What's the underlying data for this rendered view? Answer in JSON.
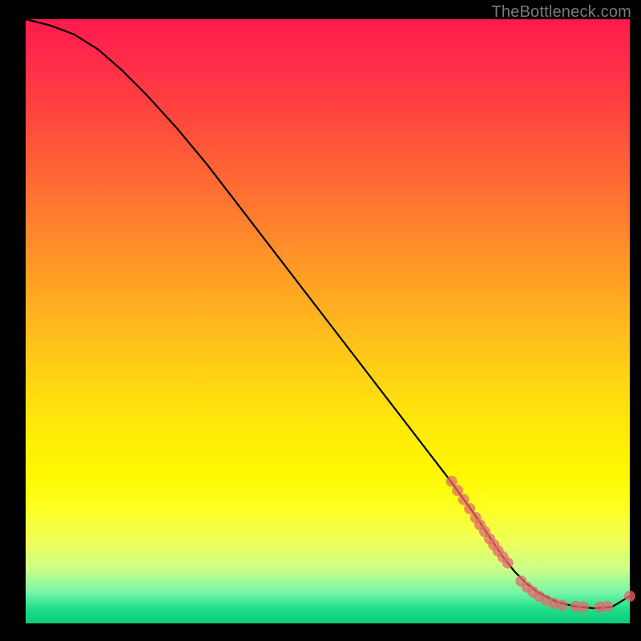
{
  "attribution": "TheBottleneck.com",
  "chart_data": {
    "type": "line",
    "title": "",
    "xlabel": "",
    "ylabel": "",
    "xlim": [
      0,
      100
    ],
    "ylim": [
      0,
      100
    ],
    "series": [
      {
        "name": "curve",
        "x": [
          0,
          4,
          8,
          12,
          16,
          20,
          25,
          30,
          35,
          40,
          45,
          50,
          55,
          60,
          65,
          70,
          74,
          77,
          79,
          81,
          83,
          85,
          88,
          91,
          94,
          97,
          100
        ],
        "y": [
          100,
          99,
          97.5,
          95,
          91.5,
          87.5,
          82,
          76,
          69.5,
          63,
          56.5,
          50,
          43.5,
          37,
          30.5,
          24,
          18.5,
          14,
          11,
          8.5,
          6.5,
          5,
          3.5,
          2.8,
          2.5,
          2.7,
          4.5
        ]
      }
    ],
    "markers": [
      {
        "x": 70.5,
        "y": 23.5
      },
      {
        "x": 71.5,
        "y": 22.0
      },
      {
        "x": 72.5,
        "y": 20.5
      },
      {
        "x": 73.5,
        "y": 19.0
      },
      {
        "x": 74.5,
        "y": 17.5
      },
      {
        "x": 75.2,
        "y": 16.3
      },
      {
        "x": 76.0,
        "y": 15.2
      },
      {
        "x": 76.8,
        "y": 14.0
      },
      {
        "x": 77.5,
        "y": 13.0
      },
      {
        "x": 78.2,
        "y": 12.0
      },
      {
        "x": 79.0,
        "y": 11.0
      },
      {
        "x": 79.8,
        "y": 10.0
      },
      {
        "x": 82.0,
        "y": 7.0
      },
      {
        "x": 83.0,
        "y": 6.0
      },
      {
        "x": 84.0,
        "y": 5.2
      },
      {
        "x": 85.0,
        "y": 4.5
      },
      {
        "x": 86.2,
        "y": 3.8
      },
      {
        "x": 87.5,
        "y": 3.3
      },
      {
        "x": 88.8,
        "y": 3.0
      },
      {
        "x": 91.0,
        "y": 2.8
      },
      {
        "x": 92.3,
        "y": 2.7
      },
      {
        "x": 95.0,
        "y": 2.7
      },
      {
        "x": 96.3,
        "y": 2.8
      },
      {
        "x": 100.0,
        "y": 4.5
      }
    ],
    "marker_color": "#e46a6a",
    "curve_color": "#000000"
  }
}
